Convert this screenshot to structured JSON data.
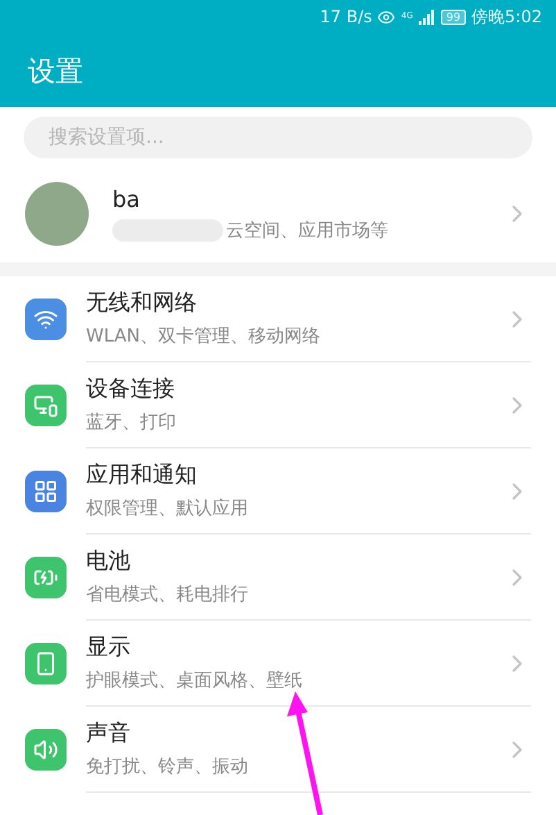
{
  "status_bar": {
    "speed": "17 B/s",
    "network": "4G",
    "battery": "99",
    "time": "傍晚5:02"
  },
  "title": "设置",
  "search": {
    "placeholder": "搜索设置项..."
  },
  "account": {
    "name": "ba",
    "subtitle": "云空间、应用市场等"
  },
  "items": [
    {
      "kind": "wifi",
      "color": "#4a8fe3",
      "title": "无线和网络",
      "subtitle": "WLAN、双卡管理、移动网络"
    },
    {
      "kind": "devices",
      "color": "#3fc46e",
      "title": "设备连接",
      "subtitle": "蓝牙、打印"
    },
    {
      "kind": "apps",
      "color": "#4a84e3",
      "title": "应用和通知",
      "subtitle": "权限管理、默认应用"
    },
    {
      "kind": "battery",
      "color": "#3fc46e",
      "title": "电池",
      "subtitle": "省电模式、耗电排行"
    },
    {
      "kind": "display",
      "color": "#3fc46e",
      "title": "显示",
      "subtitle": "护眼模式、桌面风格、壁纸"
    },
    {
      "kind": "sound",
      "color": "#3fc46e",
      "title": "声音",
      "subtitle": "免打扰、铃声、振动"
    }
  ]
}
